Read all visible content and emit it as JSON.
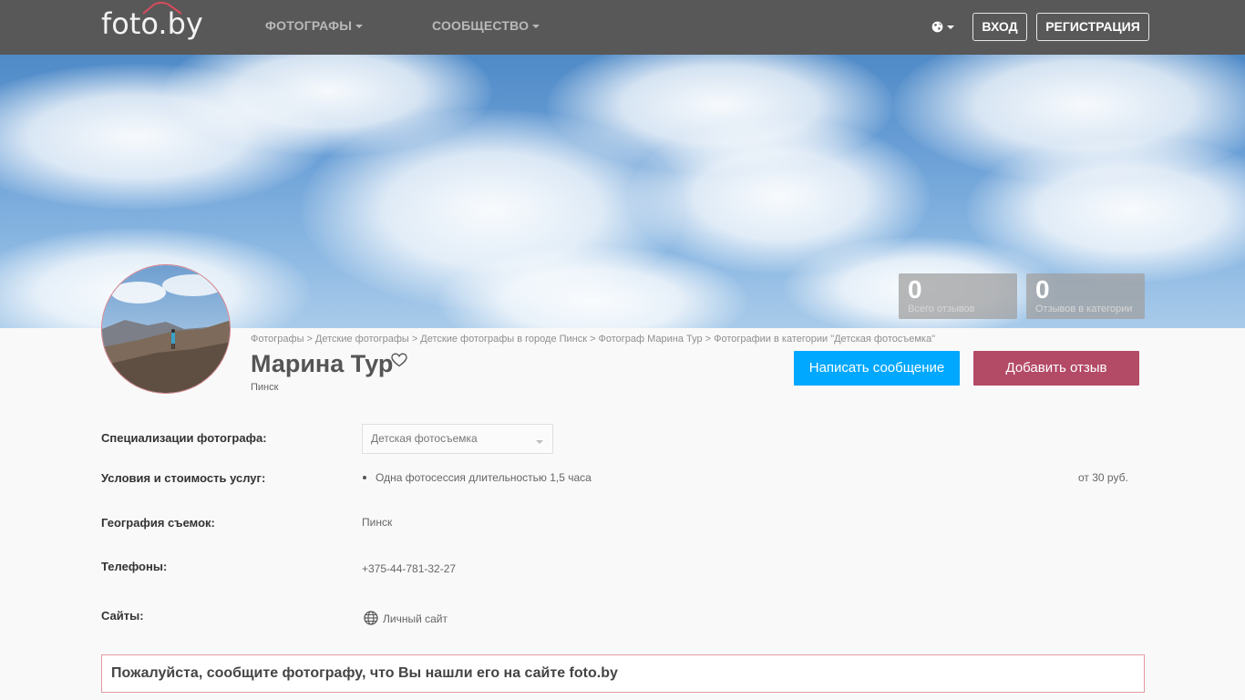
{
  "navbar": {
    "logo": "foto.by",
    "menu": [
      "Фотографы",
      "Сообщество"
    ],
    "login": "Вход",
    "register": "Регистрация"
  },
  "stats": [
    {
      "value": "0",
      "label": "Всего отзывов"
    },
    {
      "value": "0",
      "label": "Отзывов в категории"
    }
  ],
  "breadcrumb": [
    "Фотографы",
    "Детские фотографы",
    "Детские фотографы в городе Пинск",
    "Фотограф Марина Тур",
    "Фотографии в категории \"Детская фотосъемка\""
  ],
  "breadcrumb_sep": ">",
  "profile": {
    "name": "Марина Тур",
    "city": "Пинск",
    "message_button": "Написать сообщение",
    "review_button": "Добавить отзыв"
  },
  "info": {
    "specializations_label": "Специализации фотографа:",
    "specialization_selected": "Детская фотосъемка",
    "services_label": "Условия и стоимость услуг:",
    "service_item": "Одна фотосессия длительностью 1,5 часа",
    "service_price": "от 30 руб.",
    "geography_label": "География съемок:",
    "geography_value": "Пинск",
    "phones_label": "Телефоны:",
    "phone_value": "+375-44-781-32-27",
    "sites_label": "Сайты:",
    "site_link": "Личный сайт"
  },
  "notice": "Пожалуйста, сообщите фотографу, что Вы нашли его на сайте foto.by",
  "colors": {
    "navbar": "#585858",
    "message_button": "#00a8ff",
    "review_button": "#b34a66",
    "notice_border": "#e39a9f"
  },
  "icons": [
    "globe-icon",
    "heart-icon",
    "caret-down-icon",
    "site-globe-icon"
  ]
}
